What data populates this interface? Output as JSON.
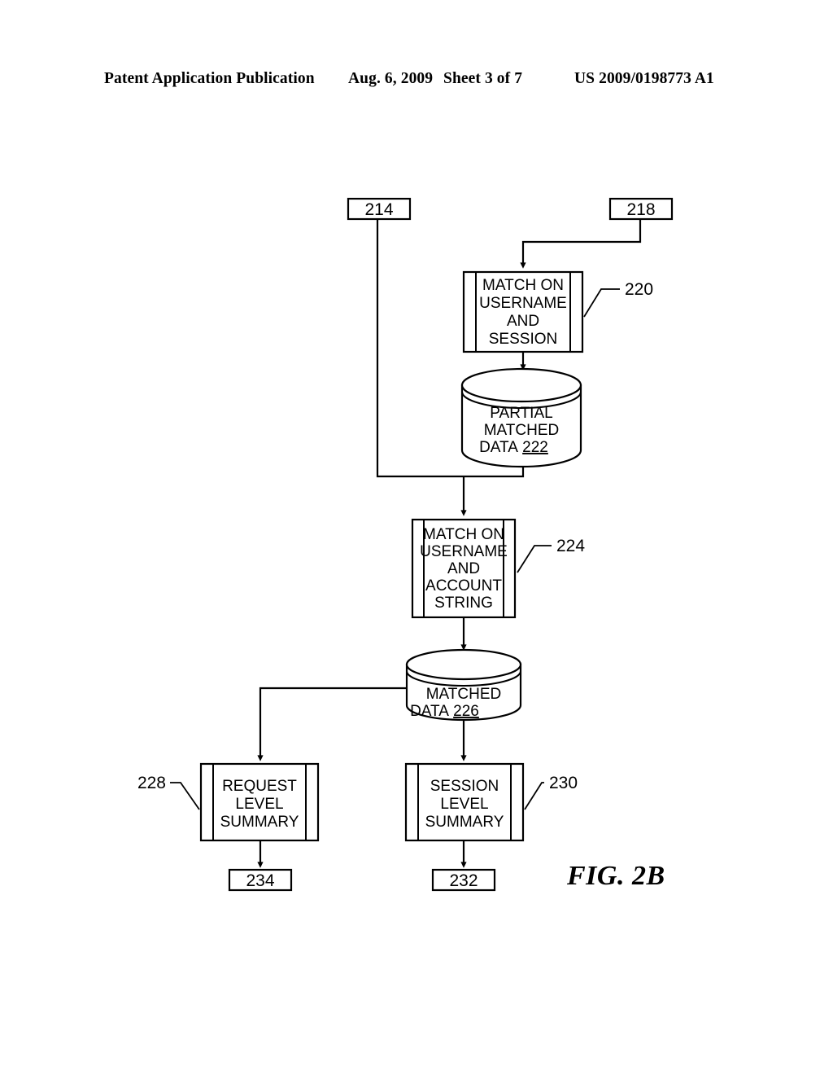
{
  "document": {
    "header": {
      "publication": "Patent Application Publication",
      "date": "Aug. 6, 2009",
      "sheet": "Sheet 3 of 7",
      "number": "US 2009/0198773 A1"
    },
    "figure_caption": "FIG. 2B"
  },
  "diagram": {
    "type": "flowchart",
    "terminals": [
      {
        "id": "214",
        "label": "214"
      },
      {
        "id": "218",
        "label": "218"
      },
      {
        "id": "234",
        "label": "234"
      },
      {
        "id": "232",
        "label": "232"
      }
    ],
    "nodes": [
      {
        "id": "220",
        "shape": "predefined-process",
        "ref": "220",
        "lines": [
          "MATCH ON",
          "USERNAME",
          "AND",
          "SESSION"
        ]
      },
      {
        "id": "222",
        "shape": "database-cylinder",
        "ref": "222",
        "lines": [
          "PARTIAL",
          "MATCHED",
          "DATA "
        ],
        "ref_inline": "222"
      },
      {
        "id": "224",
        "shape": "predefined-process",
        "ref": "224",
        "lines": [
          "MATCH ON",
          "USERNAME",
          "AND",
          "ACCOUNT",
          "STRING"
        ]
      },
      {
        "id": "226",
        "shape": "database-cylinder",
        "ref": "226",
        "lines": [
          "MATCHED",
          "DATA "
        ],
        "ref_inline": "226"
      },
      {
        "id": "228",
        "shape": "predefined-process",
        "ref": "228",
        "lines": [
          "REQUEST",
          "LEVEL",
          "SUMMARY"
        ]
      },
      {
        "id": "230",
        "shape": "predefined-process",
        "ref": "230",
        "lines": [
          "SESSION",
          "LEVEL",
          "SUMMARY"
        ]
      }
    ],
    "edges": [
      {
        "from": "218",
        "to": "220",
        "style": "orthogonal-arrow"
      },
      {
        "from": "220",
        "to": "222",
        "style": "straight-arrow"
      },
      {
        "from": "214",
        "to": "224",
        "style": "orthogonal-arrow"
      },
      {
        "from": "222",
        "to": "224",
        "style": "orthogonal-arrow"
      },
      {
        "from": "224",
        "to": "226",
        "style": "straight-arrow"
      },
      {
        "from": "226",
        "to": "228",
        "style": "orthogonal-arrow"
      },
      {
        "from": "226",
        "to": "230",
        "style": "straight-arrow"
      },
      {
        "from": "228",
        "to": "234",
        "style": "straight-arrow"
      },
      {
        "from": "230",
        "to": "232",
        "style": "straight-arrow"
      }
    ],
    "colors": {
      "stroke": "#000000",
      "fill": "#ffffff"
    }
  }
}
